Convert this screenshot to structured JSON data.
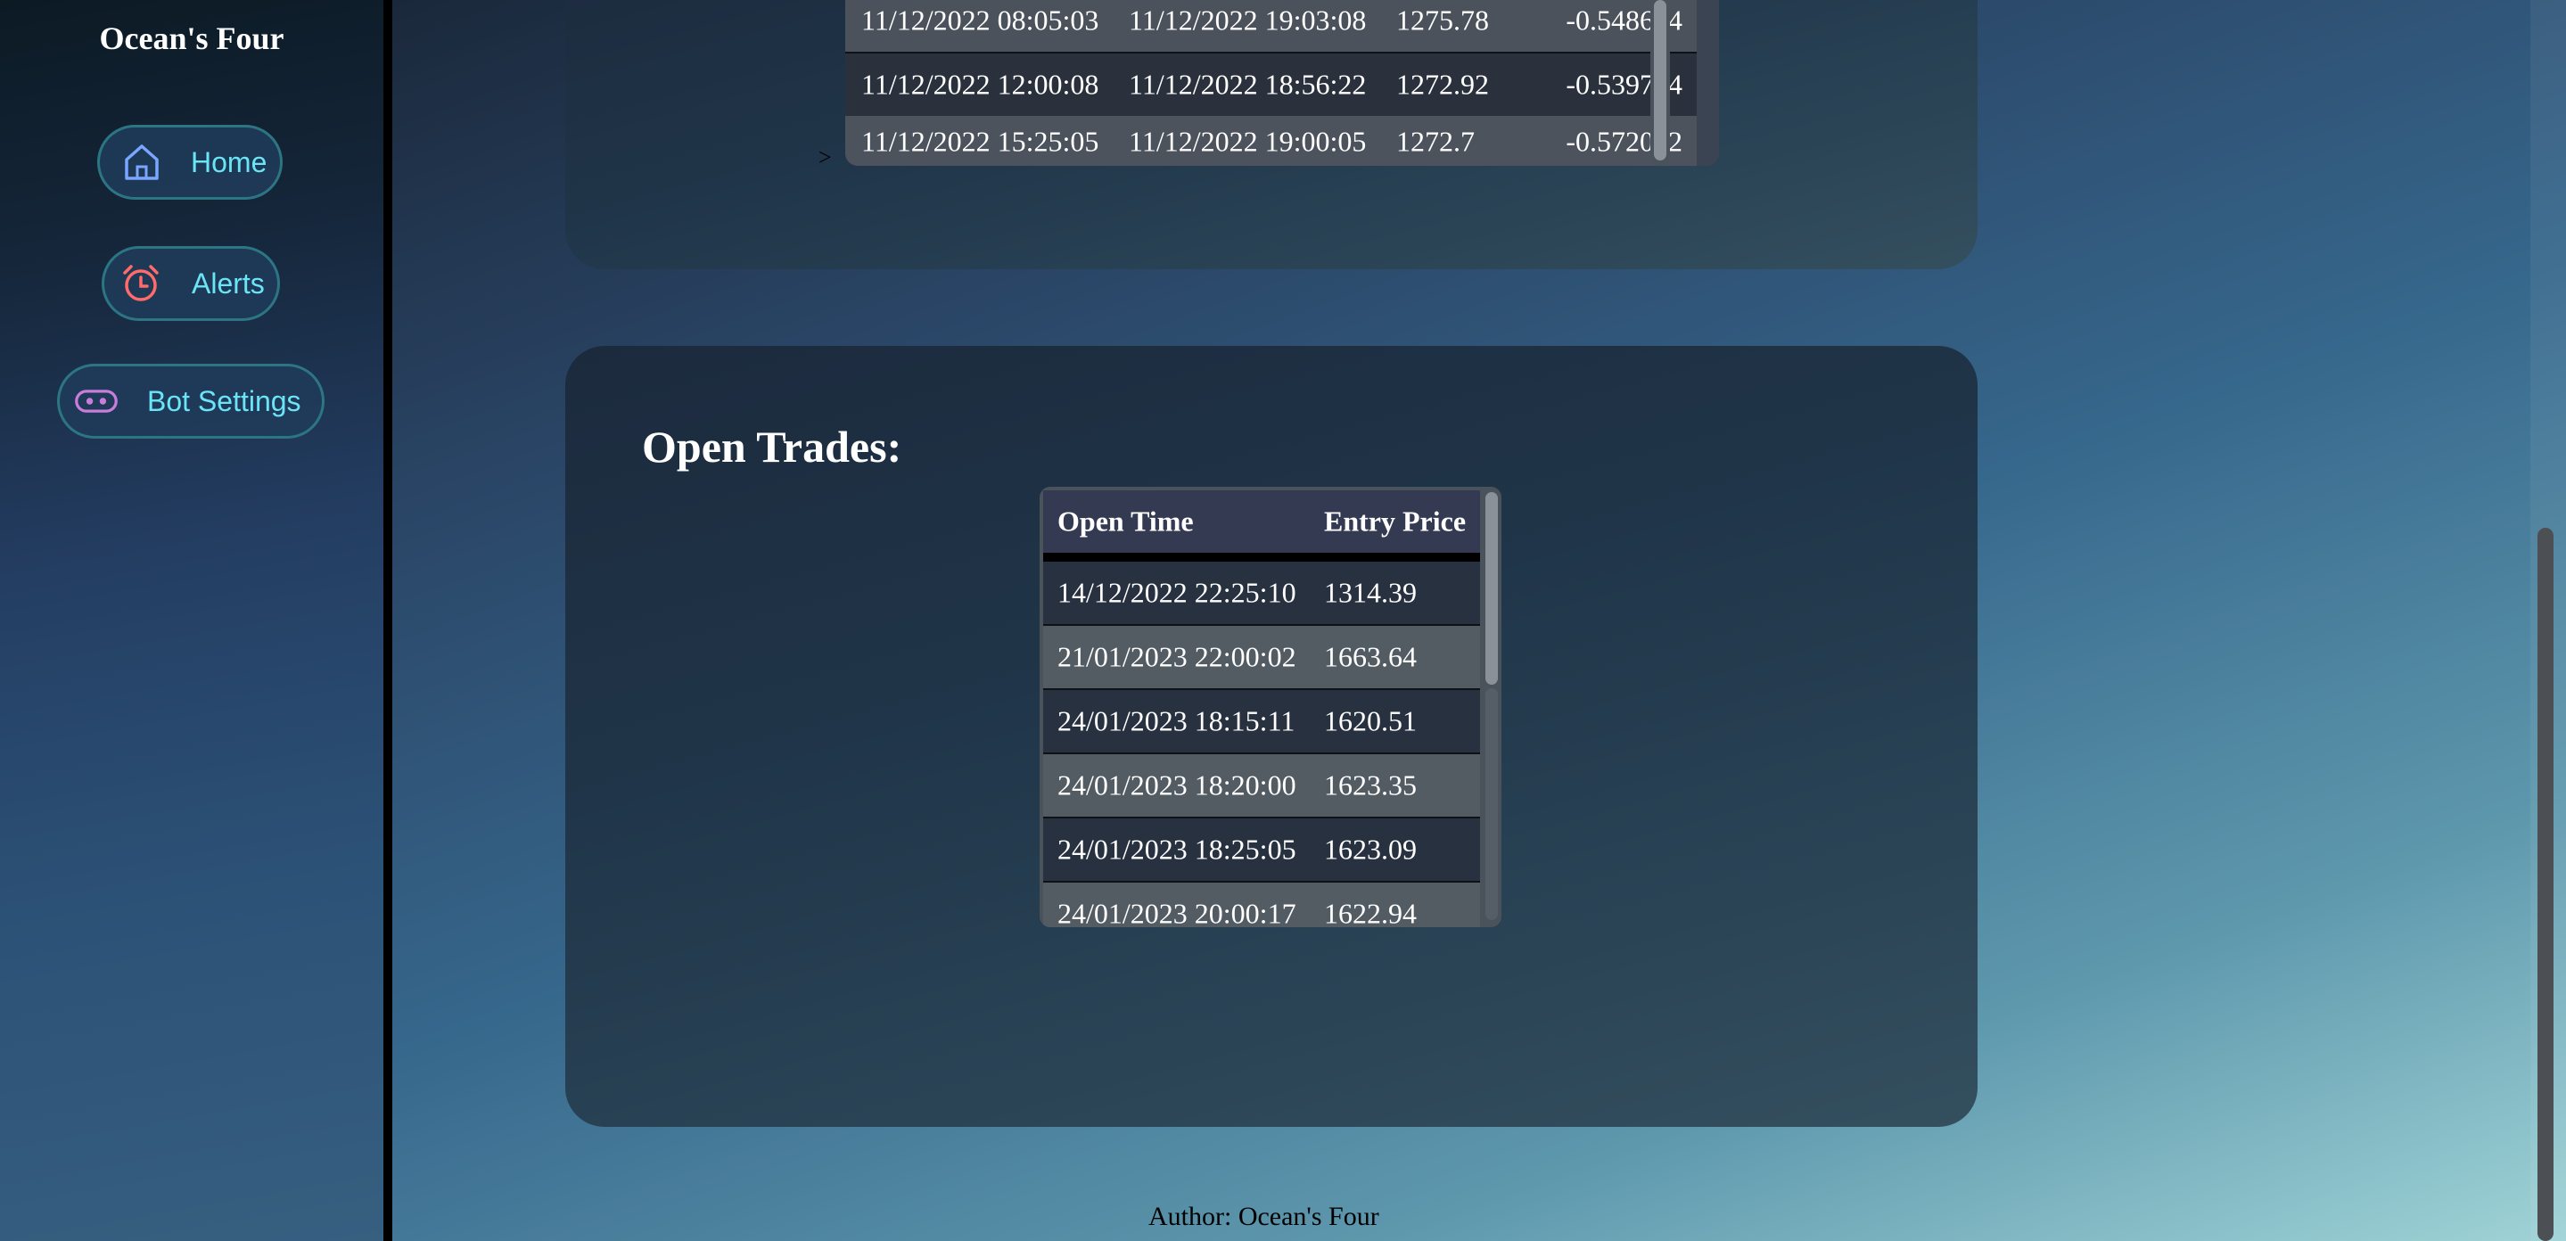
{
  "sidebar": {
    "brand": "Ocean's Four",
    "nav": [
      {
        "label": "Home",
        "icon": "home-icon"
      },
      {
        "label": "Alerts",
        "icon": "alarm-clock-icon"
      },
      {
        "label": "Bot Settings",
        "icon": "bot-icon"
      }
    ]
  },
  "closed_trades": {
    "row_marker": ">",
    "rows": [
      [
        "11/12/2022 08:05:03",
        "11/12/2022 19:03:08",
        "1275.78",
        "-0.548684"
      ],
      [
        "11/12/2022 12:00:08",
        "11/12/2022 18:56:22",
        "1272.92",
        "-0.539704"
      ],
      [
        "11/12/2022 15:25:05",
        "11/12/2022 19:00:05",
        "1272.7",
        "-0.572012"
      ]
    ]
  },
  "open_trades": {
    "title": "Open Trades:",
    "columns": [
      "Open Time",
      "Entry Price"
    ],
    "rows": [
      [
        "14/12/2022 22:25:10",
        "1314.39"
      ],
      [
        "21/01/2023 22:00:02",
        "1663.64"
      ],
      [
        "24/01/2023 18:15:11",
        "1620.51"
      ],
      [
        "24/01/2023 18:20:00",
        "1623.35"
      ],
      [
        "24/01/2023 18:25:05",
        "1623.09"
      ],
      [
        "24/01/2023 20:00:17",
        "1622.94"
      ]
    ]
  },
  "footer": {
    "text": "Author: Ocean's Four"
  },
  "colors": {
    "nav_text": "#6be4f6",
    "home_icon": "#7aa6ff",
    "alerts_icon": "#ff6b6b",
    "bot_icon": "#c77dd9"
  }
}
